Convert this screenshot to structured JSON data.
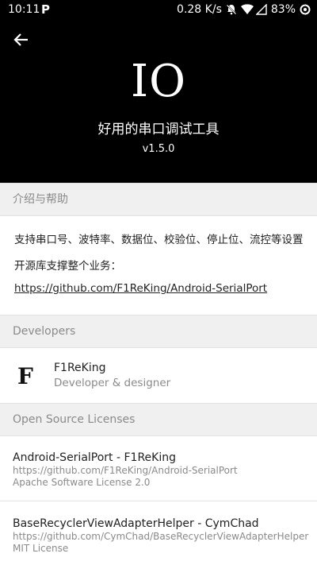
{
  "status_bar": {
    "time": "10:11",
    "app_badge": "P",
    "network_speed": "0.28 K/s",
    "battery": "83%"
  },
  "header": {
    "logo_text": "IO",
    "title": "好用的串口调试工具",
    "version": "v1.5.0"
  },
  "intro": {
    "section_label": "介绍与帮助",
    "line1": "支持串口号、波特率、数据位、校验位、停止位、流控等设置",
    "line2": "开源库支撑整个业务：",
    "link": "https://github.com/F1ReKing/Android-SerialPort"
  },
  "developers": {
    "section_label": "Developers",
    "items": [
      {
        "logo": "F",
        "name": "F1ReKing",
        "role": "Developer & designer"
      }
    ]
  },
  "licenses": {
    "section_label": "Open Source Licenses",
    "items": [
      {
        "title": "Android-SerialPort - F1ReKing",
        "url": "https://github.com/F1ReKing/Android-SerialPort",
        "license": "Apache Software License 2.0"
      },
      {
        "title": "BaseRecyclerViewAdapterHelper - CymChad",
        "url": "https://github.com/CymChad/BaseRecyclerViewAdapterHelper",
        "license": "MIT License"
      }
    ]
  },
  "colors": {
    "header_bg": "#000000",
    "section_bg": "#f0f0f0",
    "secondary_text": "#8a8a8a"
  }
}
